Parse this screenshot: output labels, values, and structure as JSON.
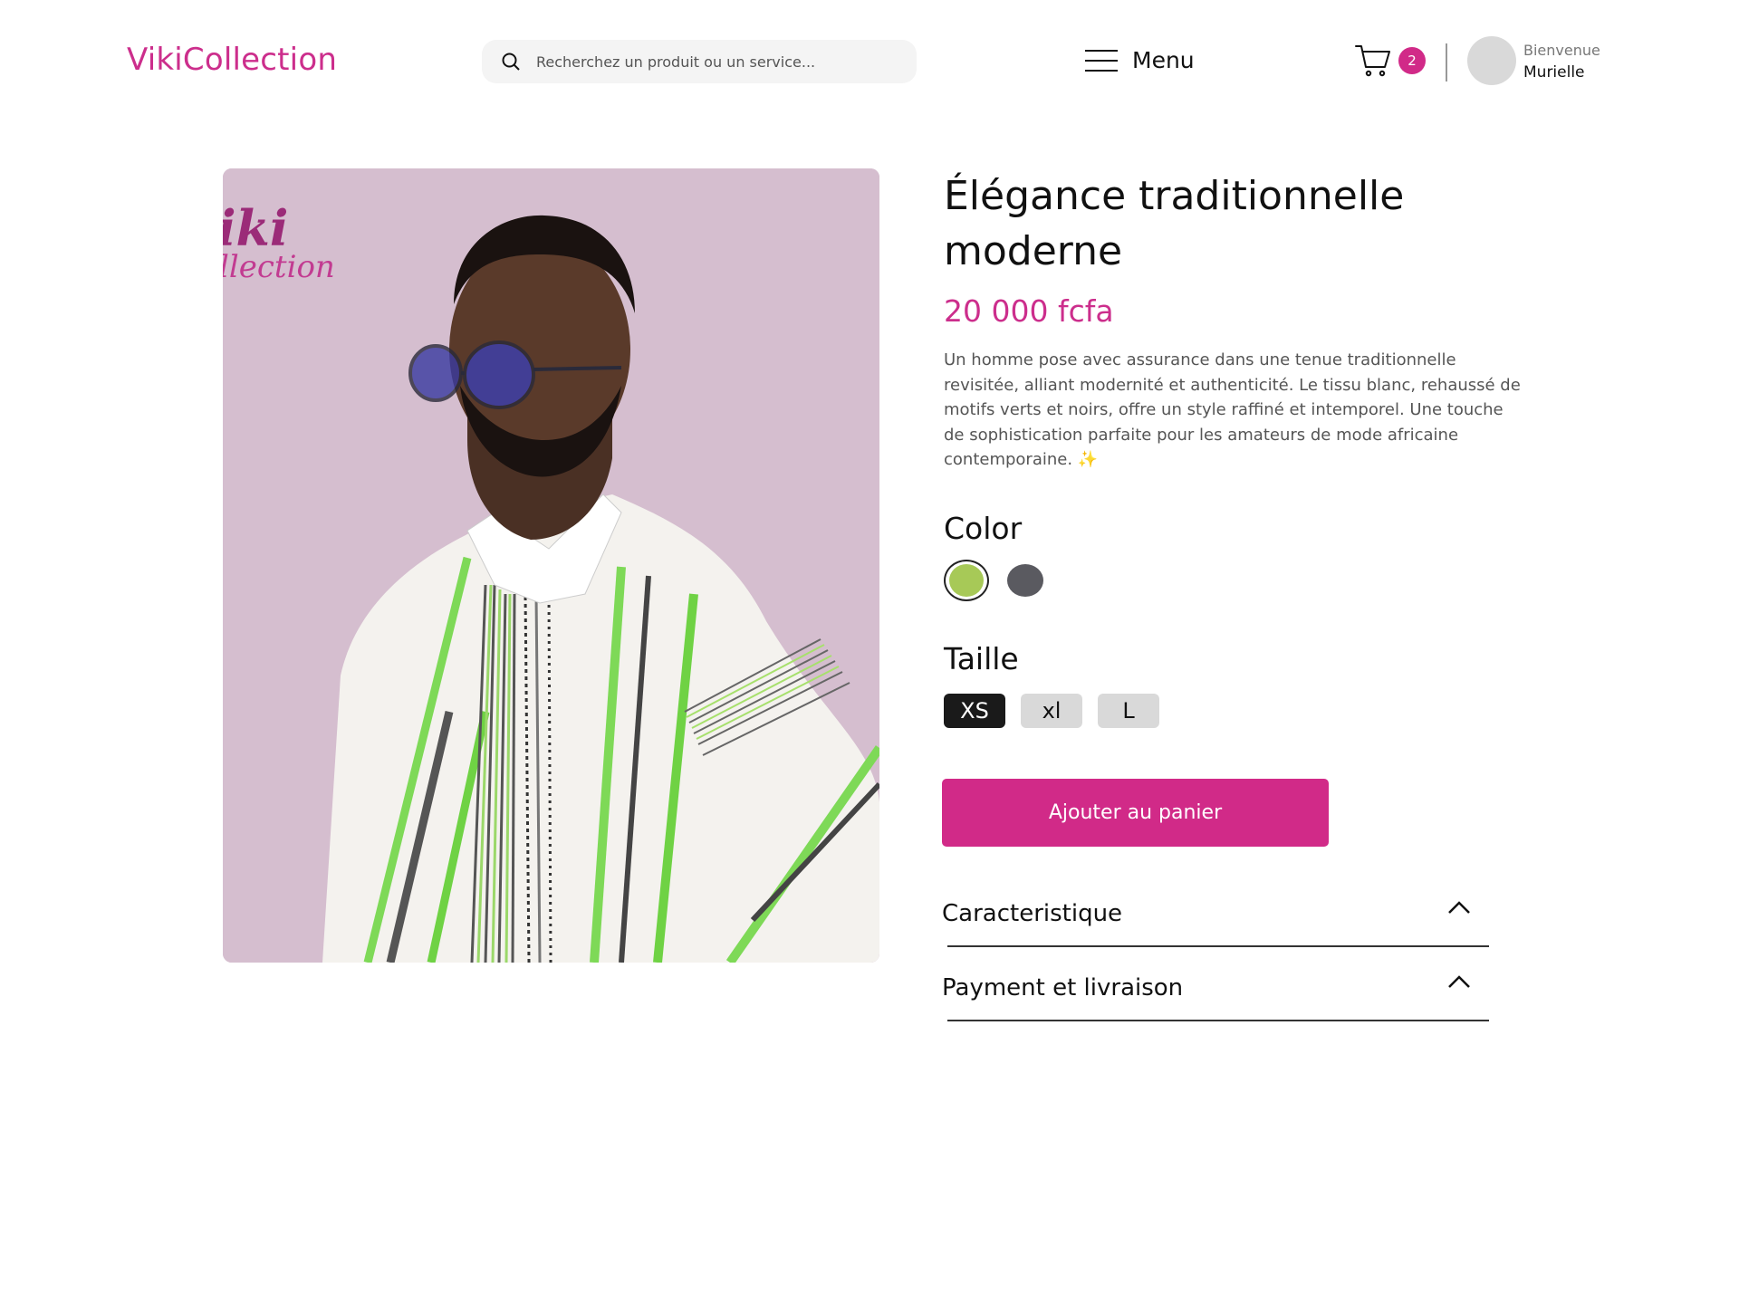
{
  "header": {
    "logo": "VikiCollection",
    "search_placeholder": "Recherchez un produit ou un service...",
    "menu_label": "Menu",
    "cart_count": "2",
    "welcome_label": "Bienvenue",
    "user_name": "Murielle"
  },
  "product": {
    "image_watermark_line1": "iki",
    "image_watermark_line2": "llection",
    "title": "Élégance traditionnelle moderne",
    "price": "20 000 fcfa",
    "description": "Un homme pose avec assurance dans une tenue traditionnelle revisitée, alliant modernité et authenticité. Le tissu blanc, rehaussé de motifs verts et noirs, offre un style raffiné et intemporel. Une touche de sophistication parfaite pour les amateurs de mode africaine contemporaine.",
    "description_emoji": "✨",
    "color_label": "Color",
    "colors": [
      {
        "name": "green",
        "hex": "#a7c957",
        "selected": true
      },
      {
        "name": "gray",
        "hex": "#5a5a60",
        "selected": false
      }
    ],
    "size_label": "Taille",
    "sizes": [
      {
        "label": "XS",
        "selected": true
      },
      {
        "label": "xl",
        "selected": false
      },
      {
        "label": "L",
        "selected": false
      }
    ],
    "add_to_cart_label": "Ajouter au panier",
    "accordions": [
      {
        "label": "Caracteristique"
      },
      {
        "label": "Payment et livraison"
      }
    ]
  },
  "theme": {
    "accent": "#d12a88",
    "text": "#111111",
    "muted": "#555555"
  }
}
